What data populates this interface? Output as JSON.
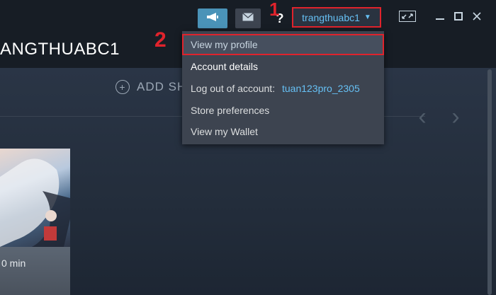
{
  "window": {
    "page_title": "ANGTHUABC1",
    "account_name": "trangthuabc1",
    "help_label": "?"
  },
  "markers": {
    "step1": "1",
    "step2": "2"
  },
  "dropdown": {
    "items": [
      {
        "label": "View my profile"
      },
      {
        "label": "Account details"
      },
      {
        "label": "Log out of account:",
        "user": "tuan123pro_2305"
      },
      {
        "label": "Store preferences"
      },
      {
        "label": "View my Wallet"
      }
    ]
  },
  "library": {
    "add_shelf_label": "ADD SH",
    "game_playtime": "0 min"
  },
  "colors": {
    "accent": "#66c0f4",
    "highlight_border": "#e0232c",
    "announce_button": "#4a93b8"
  },
  "icons": {
    "announce": "megaphone-icon",
    "mail": "envelope-icon",
    "minimize": "minimize-icon",
    "maximize": "maximize-icon",
    "close": "close-icon",
    "fullscreen": "big-picture-icon"
  }
}
